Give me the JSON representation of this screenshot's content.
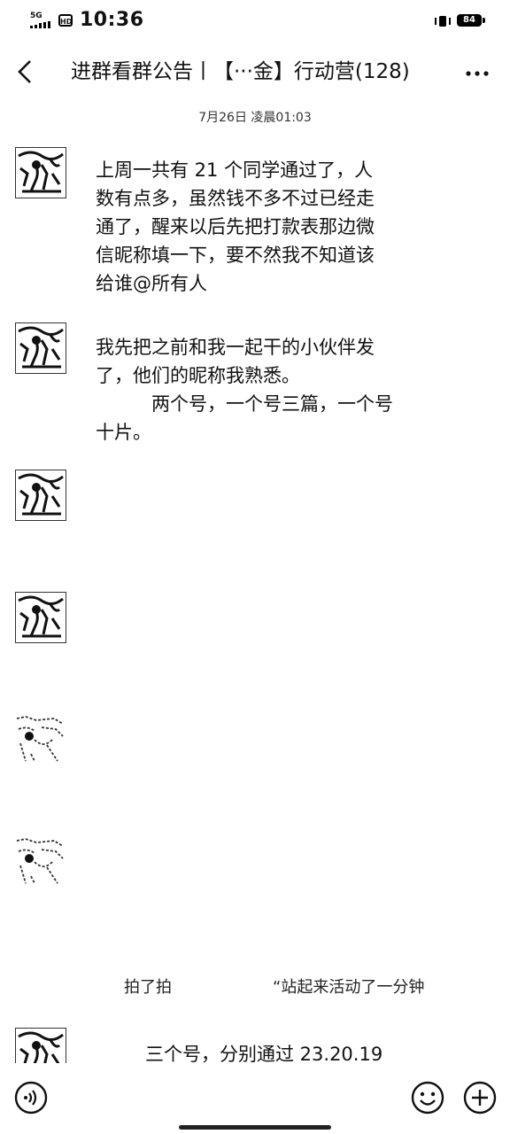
{
  "status_bar": {
    "network": "5G",
    "hd": "HD",
    "time": "10:36",
    "battery": "84"
  },
  "header": {
    "title": "进群看群公告丨【···金】行动营(128)"
  },
  "date_separator": "7月26日 凌晨01:03",
  "messages": [
    {
      "lines": [
        "上周一共有 21 个同学通过了，人",
        "数有点多，虽然钱不多不过已经走",
        "通了，醒来以后先把打款表那边微",
        "信昵称填一下，要不然我不知道该",
        "给谁@所有人"
      ]
    },
    {
      "lines": [
        "我先把之前和我一起干的小伙伴发",
        "了，他们的昵称我熟悉。",
        "　　　两个号，一个号三篇，一个号",
        "十片。"
      ]
    }
  ],
  "system_pat": {
    "left": "拍了拍",
    "right": "“站起来活动了一分钟"
  },
  "last_message": "三个号，分别通过 23.20.19"
}
